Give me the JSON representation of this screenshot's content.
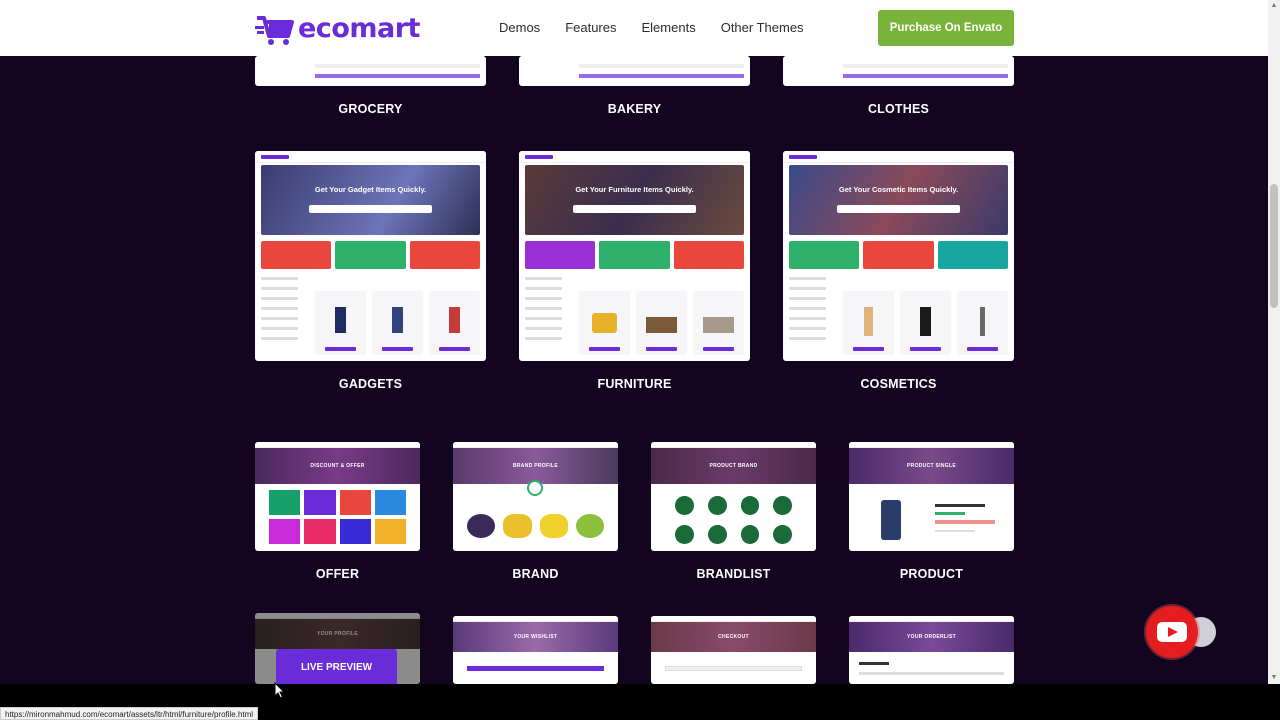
{
  "header": {
    "logo_text": "ecomart",
    "nav": [
      "Demos",
      "Features",
      "Elements",
      "Other Themes"
    ],
    "purchase_label": "Purchase On Envato",
    "accent": "#6a2bd8",
    "purchase_color": "#7ab33a"
  },
  "demos_row1": [
    {
      "label": "GROCERY"
    },
    {
      "label": "BAKERY"
    },
    {
      "label": "CLOTHES"
    }
  ],
  "demos_row2": [
    {
      "label": "GADGETS",
      "hero_text": "Get Your Gadget Items Quickly."
    },
    {
      "label": "FURNITURE",
      "hero_text": "Get Your Furniture Items Quickly."
    },
    {
      "label": "COSMETICS",
      "hero_text": "Get Your Cosmetic Items Quickly."
    }
  ],
  "pages_row1": [
    {
      "label": "OFFER",
      "banner": "DISCOUNT & OFFER"
    },
    {
      "label": "BRAND",
      "banner": "BRAND PROFILE"
    },
    {
      "label": "BRANDLIST",
      "banner": "PRODUCT BRAND"
    },
    {
      "label": "PRODUCT",
      "banner": "PRODUCT SINGLE"
    }
  ],
  "pages_row2": [
    {
      "banner": "YOUR PROFILE"
    },
    {
      "banner": "YOUR WISHLIST"
    },
    {
      "banner": "CHECKOUT"
    },
    {
      "banner": "YOUR ORDERLIST"
    }
  ],
  "live_preview_label": "LIVE PREVIEW",
  "status_url": "https://mironmahmud.com/ecomart/assets/ltr/html/furniture/profile.html"
}
